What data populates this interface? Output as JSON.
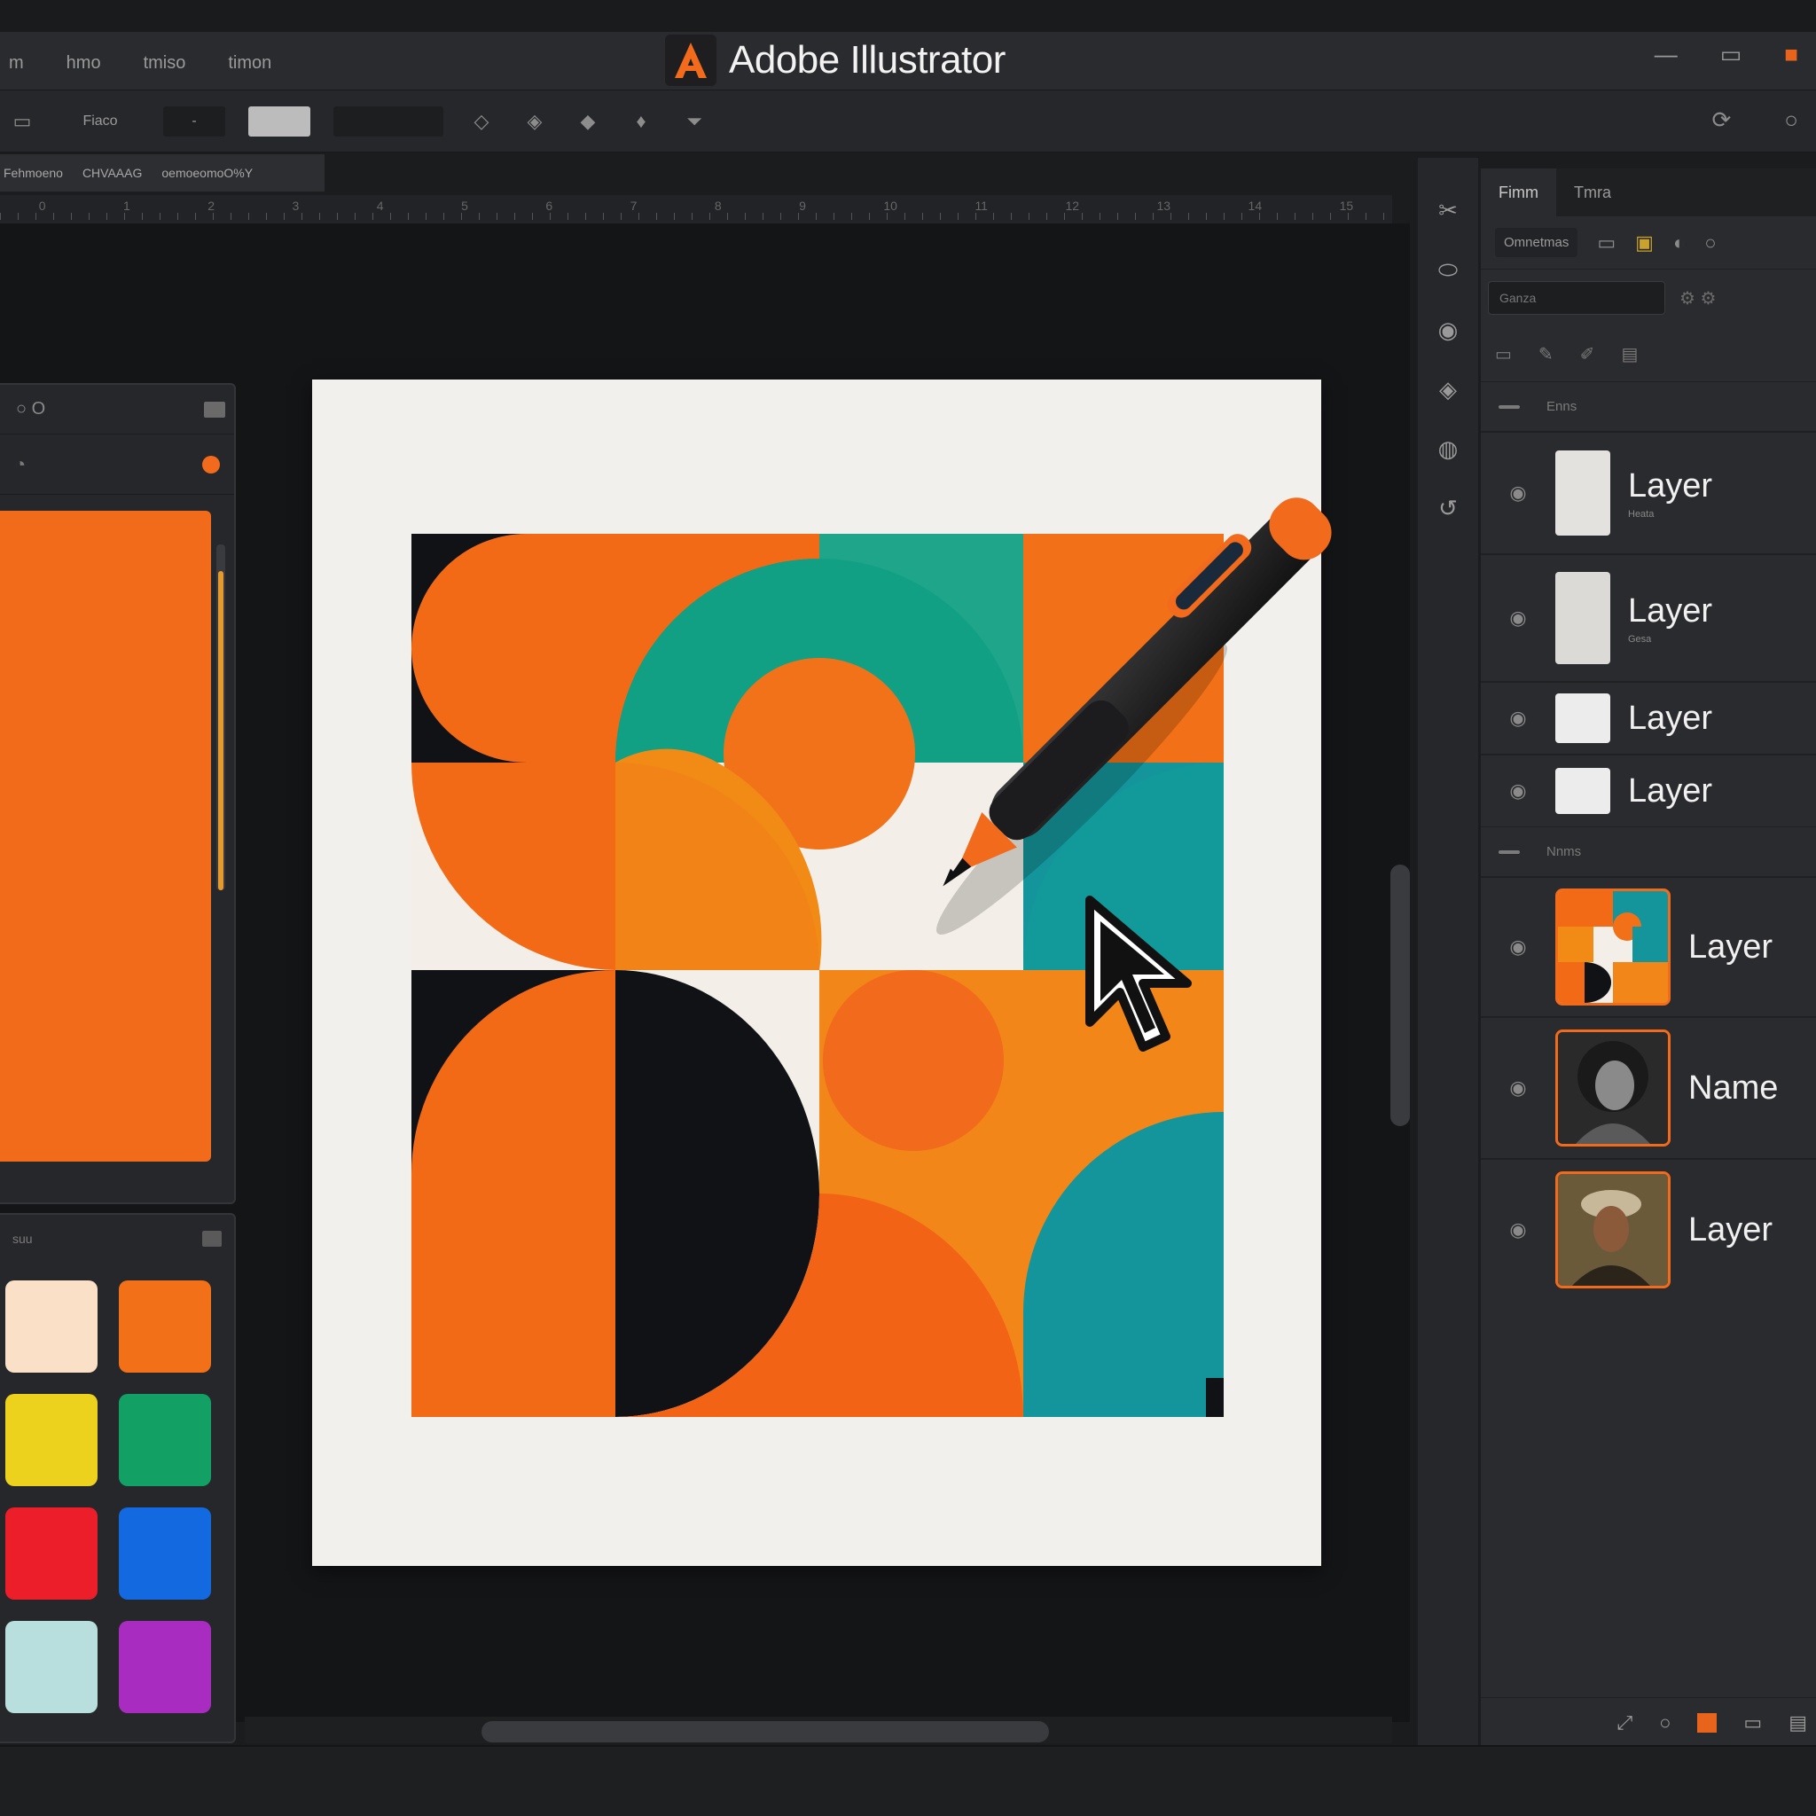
{
  "app": {
    "title": "Adobe Illustrator"
  },
  "menu": [
    "m",
    "hmo",
    "tmiso",
    "timon"
  ],
  "window_controls": {
    "minimize": "—",
    "maximize": "▭",
    "close": "■"
  },
  "control_bar": {
    "field_label": "Fiaco",
    "stroke_value": "-"
  },
  "doc_tabs": [
    "Fehmoeno",
    "CHVAAAG",
    "oemoeomoO%Y"
  ],
  "ruler_labels": [
    "0",
    "1",
    "2",
    "3",
    "4",
    "5",
    "6",
    "7",
    "8",
    "9",
    "10",
    "11",
    "12",
    "13",
    "14",
    "15"
  ],
  "right_panel": {
    "tabs": [
      "Fimm",
      "Tmra"
    ],
    "panel_label": "Omnetmas",
    "filter_placeholder": "Ganza",
    "group1_label": "Enns",
    "group2_label": "Nnms",
    "layers": [
      {
        "name": "Layer",
        "sub": "Heata",
        "thumb": "texture"
      },
      {
        "name": "Layer",
        "sub": "Gesa",
        "thumb": "texture"
      },
      {
        "name": "Layer",
        "sub": "",
        "thumb": "plain"
      },
      {
        "name": "Layer",
        "sub": "",
        "thumb": "plain"
      }
    ],
    "layers2": [
      {
        "name": "Layer",
        "thumb": "artwork"
      },
      {
        "name": "Name",
        "thumb": "portrait-bw"
      },
      {
        "name": "Layer",
        "thumb": "portrait-color"
      }
    ]
  },
  "left_panel": {
    "header": "○ O",
    "swatches_label": "suu"
  },
  "colors": {
    "accent": "#f26a1b",
    "teal": "#14959b",
    "green_teal": "#10a07a",
    "black": "#101215",
    "paper": "#f1f0ec",
    "swatches": [
      "#fbe0c8",
      "#f27017",
      "#ecd21c",
      "#12a064",
      "#ec1e2a",
      "#1369e0",
      "#b8dedd",
      "#a82cbf"
    ]
  },
  "icons": [
    "adobe-a-icon",
    "pen-tool-icon",
    "cursor-arrow-icon",
    "eye-icon"
  ]
}
